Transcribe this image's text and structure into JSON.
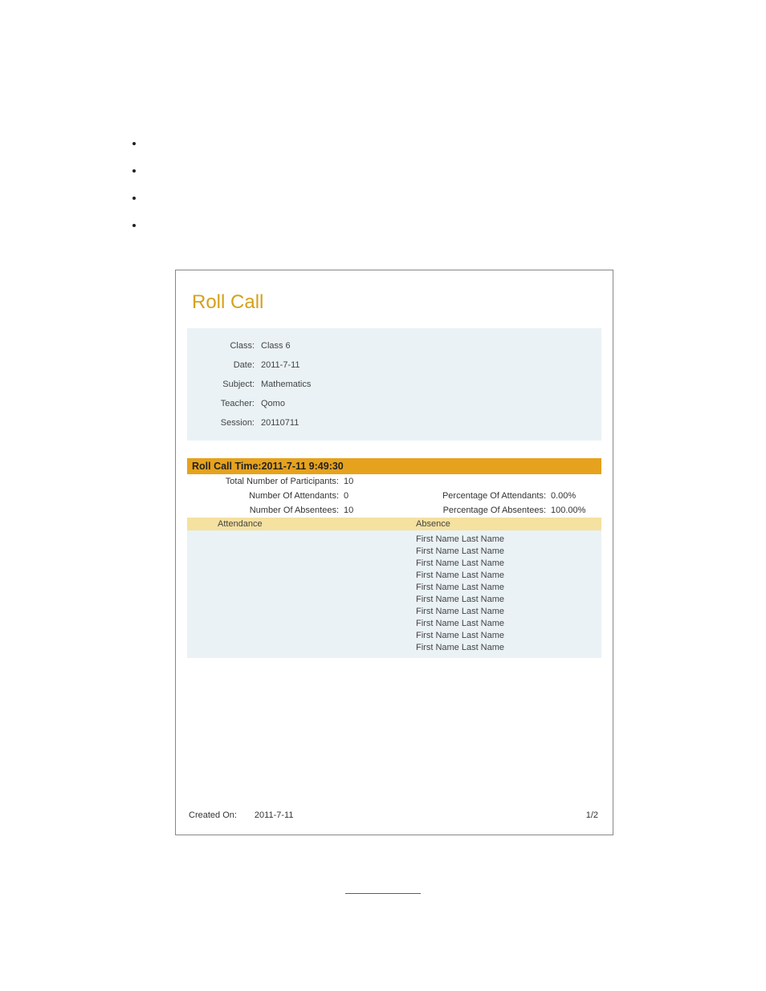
{
  "title": "Roll Call",
  "header": {
    "class_label": "Class:",
    "class_value": "Class 6",
    "date_label": "Date:",
    "date_value": "2011-7-11",
    "subject_label": "Subject:",
    "subject_value": "Mathematics",
    "teacher_label": "Teacher:",
    "teacher_value": "Qomo",
    "session_label": "Session:",
    "session_value": "20110711"
  },
  "time_bar": "Roll Call Time:2011-7-11   9:49:30",
  "stats": {
    "total_label": "Total Number of Participants:",
    "total_value": "10",
    "att_label": "Number Of Attendants:",
    "att_value": "0",
    "att_pct_label": "Percentage Of Attendants:",
    "att_pct_value": "0.00%",
    "abs_label": "Number Of Absentees:",
    "abs_value": "10",
    "abs_pct_label": "Percentage Of Absentees:",
    "abs_pct_value": "100.00%"
  },
  "columns": {
    "attendance": "Attendance",
    "absence": "Absence"
  },
  "absence_rows": [
    "First Name Last Name",
    "First Name Last Name",
    "First Name Last Name",
    "First Name Last Name",
    "First Name Last Name",
    "First Name Last Name",
    "First Name Last Name",
    "First Name Last Name",
    "First Name Last Name",
    "First Name Last Name"
  ],
  "footer": {
    "created_label": "Created On:",
    "created_value": "2011-7-11",
    "page": "1/2"
  }
}
